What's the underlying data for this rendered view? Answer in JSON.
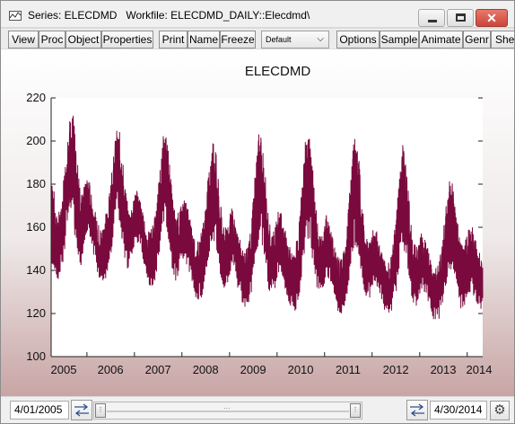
{
  "window": {
    "title": "Series: ELECDMD   Workfile: ELECDMD_DAILY::Elecdmd\\",
    "close_glyph": "✕"
  },
  "toolbar": {
    "buttons": [
      "View",
      "Proc",
      "Object",
      "Properties",
      "Print",
      "Name",
      "Freeze",
      "Options",
      "Sample",
      "Animate",
      "Genr",
      "Sheet"
    ],
    "display_select": "Default",
    "display_select_chevron": "⌵"
  },
  "colors": {
    "series_line": "#7a0a3d",
    "plot_background": "#ffffff",
    "window_gradient_bottom": "#c8a5a5"
  },
  "chart_data": {
    "type": "line",
    "title": "ELECDMD",
    "ylim": [
      100,
      220
    ],
    "yticks": [
      100,
      120,
      140,
      160,
      180,
      200,
      220
    ],
    "xlabels": [
      "2005",
      "2006",
      "2007",
      "2008",
      "2009",
      "2010",
      "2011",
      "2012",
      "2013",
      "2014"
    ],
    "x_range": [
      "2005-04-01",
      "2014-04-30"
    ],
    "grid": false,
    "series": [
      {
        "x": [
          "2005-04",
          "2005-05",
          "2005-06",
          "2005-07",
          "2005-08",
          "2005-09",
          "2005-10",
          "2005-11",
          "2005-12",
          "2006-01",
          "2006-02",
          "2006-03",
          "2006-04",
          "2006-05",
          "2006-06",
          "2006-07",
          "2006-08",
          "2006-09",
          "2006-10",
          "2006-11",
          "2006-12",
          "2007-01",
          "2007-02",
          "2007-03",
          "2007-04",
          "2007-05",
          "2007-06",
          "2007-07",
          "2007-08",
          "2007-09",
          "2007-10",
          "2007-11",
          "2007-12",
          "2008-01",
          "2008-02",
          "2008-03",
          "2008-04",
          "2008-05",
          "2008-06",
          "2008-07",
          "2008-08",
          "2008-09",
          "2008-10",
          "2008-11",
          "2008-12",
          "2009-01",
          "2009-02",
          "2009-03",
          "2009-04",
          "2009-05",
          "2009-06",
          "2009-07",
          "2009-08",
          "2009-09",
          "2009-10",
          "2009-11",
          "2009-12",
          "2010-01",
          "2010-02",
          "2010-03",
          "2010-04",
          "2010-05",
          "2010-06",
          "2010-07",
          "2010-08",
          "2010-09",
          "2010-10",
          "2010-11",
          "2010-12",
          "2011-01",
          "2011-02",
          "2011-03",
          "2011-04",
          "2011-05",
          "2011-06",
          "2011-07",
          "2011-08",
          "2011-09",
          "2011-10",
          "2011-11",
          "2011-12",
          "2012-01",
          "2012-02",
          "2012-03",
          "2012-04",
          "2012-05",
          "2012-06",
          "2012-07",
          "2012-08",
          "2012-09",
          "2012-10",
          "2012-11",
          "2012-12",
          "2013-01",
          "2013-02",
          "2013-03",
          "2013-04",
          "2013-05",
          "2013-06",
          "2013-07",
          "2013-08",
          "2013-09",
          "2013-10",
          "2013-11",
          "2013-12",
          "2014-01",
          "2014-02",
          "2014-03",
          "2014-04"
        ],
        "low": [
          140,
          132,
          136,
          148,
          168,
          160,
          144,
          140,
          152,
          156,
          148,
          140,
          132,
          132,
          138,
          150,
          168,
          158,
          142,
          138,
          146,
          152,
          150,
          142,
          132,
          130,
          134,
          148,
          160,
          154,
          138,
          132,
          140,
          144,
          140,
          134,
          126,
          124,
          128,
          142,
          150,
          150,
          136,
          130,
          132,
          140,
          134,
          128,
          122,
          120,
          126,
          140,
          150,
          148,
          132,
          126,
          130,
          138,
          136,
          126,
          120,
          118,
          124,
          138,
          150,
          150,
          134,
          128,
          128,
          136,
          134,
          126,
          118,
          118,
          122,
          136,
          148,
          148,
          132,
          126,
          126,
          134,
          130,
          124,
          118,
          116,
          120,
          132,
          146,
          146,
          130,
          122,
          122,
          130,
          128,
          122,
          116,
          114,
          118,
          128,
          138,
          138,
          126,
          120,
          122,
          128,
          126,
          122,
          120
        ],
        "high": [
          182,
          166,
          170,
          188,
          210,
          214,
          194,
          176,
          180,
          184,
          174,
          164,
          160,
          164,
          172,
          188,
          206,
          204,
          184,
          168,
          172,
          178,
          174,
          164,
          158,
          160,
          168,
          186,
          206,
          200,
          178,
          166,
          168,
          174,
          170,
          160,
          154,
          154,
          164,
          180,
          200,
          198,
          176,
          160,
          162,
          170,
          164,
          156,
          150,
          150,
          160,
          184,
          206,
          200,
          174,
          158,
          160,
          170,
          164,
          156,
          150,
          150,
          158,
          182,
          208,
          202,
          176,
          158,
          156,
          166,
          160,
          152,
          146,
          146,
          156,
          180,
          202,
          198,
          172,
          156,
          154,
          160,
          158,
          150,
          144,
          144,
          154,
          176,
          200,
          196,
          170,
          154,
          152,
          158,
          154,
          148,
          142,
          142,
          150,
          166,
          182,
          180,
          164,
          152,
          154,
          160,
          160,
          154,
          148
        ]
      }
    ]
  },
  "sample": {
    "start": "4/01/2005",
    "end": "4/30/2014"
  }
}
